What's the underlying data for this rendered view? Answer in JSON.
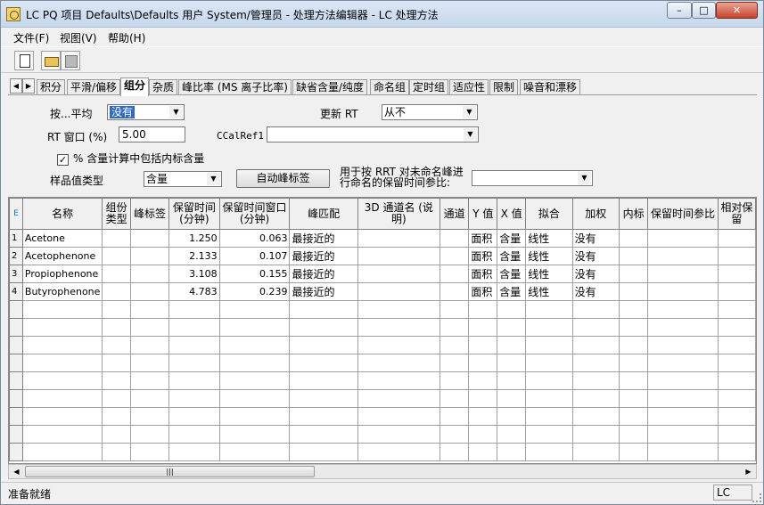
{
  "window": {
    "title": "LC PQ 项目 Defaults\\Defaults 用户 System/管理员 - 处理方法编辑器 - LC 处理方法",
    "minimize": "–",
    "maximize": "□",
    "close": "✕"
  },
  "menu": [
    "文件(F)",
    "视图(V)",
    "帮助(H)"
  ],
  "tabs": [
    "积分",
    "平滑/偏移",
    "组分",
    "杂质",
    "峰比率 (MS 离子比率)",
    "缺省含量/纯度",
    "命名组",
    "定时组",
    "适应性",
    "限制",
    "噪音和漂移"
  ],
  "active_tab": "组分",
  "form": {
    "by_avg_label": "按...平均",
    "by_avg_value": "没有",
    "update_rt_label": "更新 RT",
    "update_rt_value": "从不",
    "rt_window_label": "RT 窗口 (%)",
    "rt_window_value": "5.00",
    "ccalref_label": "CCalRef1",
    "ccalref_value": "",
    "checkbox_label": "% 含量计算中包括内标含量",
    "checkbox_checked": "✓",
    "sample_type_label": "样品值类型",
    "sample_type_value": "含量",
    "auto_peak_button": "自动峰标签",
    "rrt_label_1": "用于按 RRT 对未命名峰进",
    "rrt_label_2": "行命名的保留时间参比:",
    "rrt_value": ""
  },
  "table": {
    "corner": "E",
    "columns": [
      "名称",
      "组份\n类型",
      "峰标签",
      "保留时间\n(分钟)",
      "保留时间窗口\n(分钟)",
      "峰匹配",
      "3D 通道名 (说明)",
      "通道",
      "Y 值",
      "X 值",
      "拟合",
      "加权",
      "内标",
      "保留时间参比",
      "相对保留"
    ],
    "rows": [
      {
        "num": "1",
        "name": "Acetone",
        "type": "",
        "label": "",
        "rt": "1.250",
        "rtw": "0.063",
        "match": "最接近的",
        "ch3d": "",
        "ch": "",
        "y": "面积",
        "x": "含量",
        "fit": "线性",
        "weight": "没有",
        "is": "",
        "rtref": "",
        "rel": ""
      },
      {
        "num": "2",
        "name": "Acetophenone",
        "type": "",
        "label": "",
        "rt": "2.133",
        "rtw": "0.107",
        "match": "最接近的",
        "ch3d": "",
        "ch": "",
        "y": "面积",
        "x": "含量",
        "fit": "线性",
        "weight": "没有",
        "is": "",
        "rtref": "",
        "rel": ""
      },
      {
        "num": "3",
        "name": "Propiophenone",
        "type": "",
        "label": "",
        "rt": "3.108",
        "rtw": "0.155",
        "match": "最接近的",
        "ch3d": "",
        "ch": "",
        "y": "面积",
        "x": "含量",
        "fit": "线性",
        "weight": "没有",
        "is": "",
        "rtref": "",
        "rel": ""
      },
      {
        "num": "4",
        "name": "Butyrophenone",
        "type": "",
        "label": "",
        "rt": "4.783",
        "rtw": "0.239",
        "match": "最接近的",
        "ch3d": "",
        "ch": "",
        "y": "面积",
        "x": "含量",
        "fit": "线性",
        "weight": "没有",
        "is": "",
        "rtref": "",
        "rel": ""
      }
    ],
    "empty_rows": 9
  },
  "scroll": {
    "left": "◀",
    "right": "▶",
    "thumb": "|||"
  },
  "status": {
    "text": "准备就绪",
    "panel": "LC"
  }
}
